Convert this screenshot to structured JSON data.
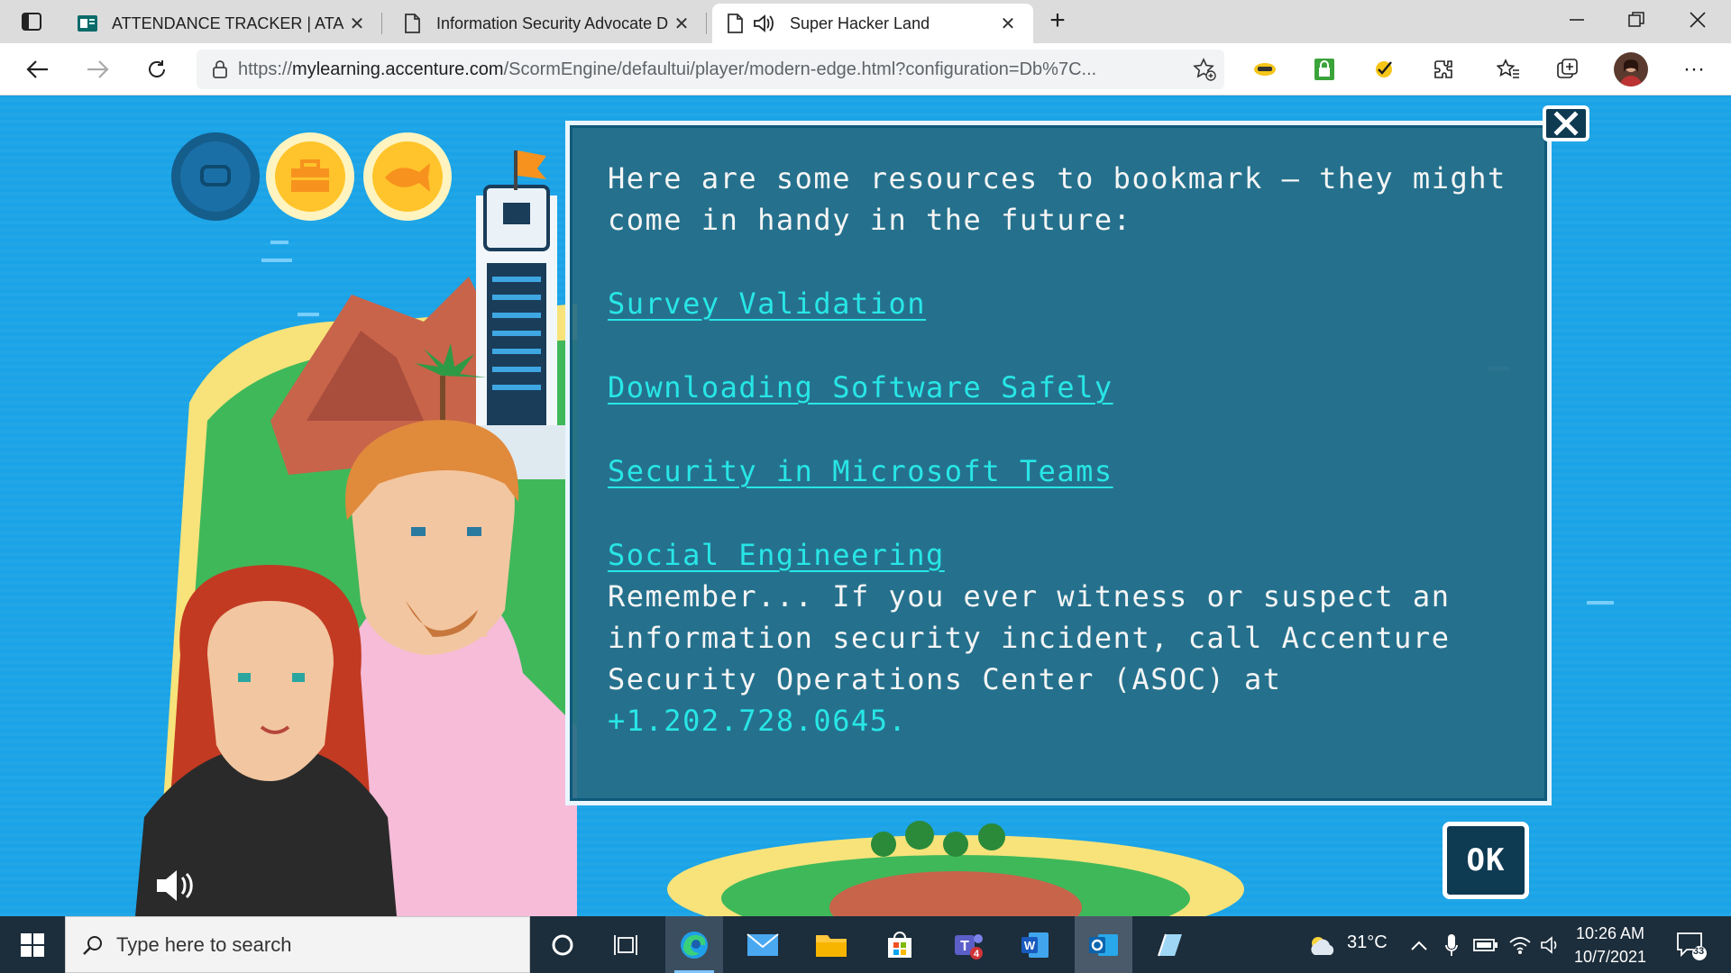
{
  "browser": {
    "tabs": [
      {
        "title": "ATTENDANCE TRACKER | ATAS S",
        "active": false,
        "icon": "forms-icon"
      },
      {
        "title": "Information Security Advocate D",
        "active": false,
        "icon": "page-icon"
      },
      {
        "title": "Super Hacker Land",
        "active": true,
        "icon": "page-icon"
      }
    ],
    "url_prefix": "https://",
    "url_host": "mylearning.accenture.com",
    "url_path": "/ScormEngine/defaultui/player/modern-edge.html?configuration=Db%7C...",
    "tab_close_glyph": "✕",
    "new_tab_glyph": "+",
    "menu_glyph": "···"
  },
  "dialog": {
    "intro": "Here are some resources to bookmark – they might come in handy in the future:",
    "links": [
      "Survey Validation",
      "Downloading Software Safely",
      "Security in Microsoft Teams",
      "Social Engineering"
    ],
    "remember_text": "Remember... If you ever witness or suspect an information security incident, call Accenture Security Operations Center (ASOC) at ",
    "phone": "+1.202.728.0645.",
    "ok_label": "OK"
  },
  "taskbar": {
    "search_placeholder": "Type here to search",
    "weather_temp": "31°C",
    "time": "10:26 AM",
    "date": "10/7/2021",
    "notification_count": "33"
  },
  "colors": {
    "link": "#28e6e6",
    "dialog_bg": "#266c86",
    "ocean": "#1aa3e6"
  }
}
